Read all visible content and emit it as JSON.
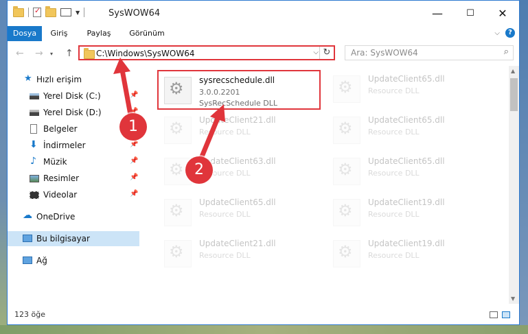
{
  "window": {
    "title": "SysWOW64",
    "buttons": {
      "minimize": "—",
      "maximize": "☐",
      "close": "✕"
    }
  },
  "ribbon": {
    "tabs": [
      "Dosya",
      "Giriş",
      "Paylaş",
      "Görünüm"
    ],
    "help": "?"
  },
  "address": {
    "path": "C:\\Windows\\SysWOW64",
    "search_placeholder": "Ara: SysWOW64"
  },
  "sidebar": {
    "items": [
      {
        "label": "Hızlı erişim",
        "icon": "star-icon",
        "pinned": false
      },
      {
        "label": "Yerel Disk (C:)",
        "icon": "drive-icon",
        "pinned": true
      },
      {
        "label": "Yerel Disk (D:)",
        "icon": "drive-icon",
        "pinned": true
      },
      {
        "label": "Belgeler",
        "icon": "documents-icon",
        "pinned": true
      },
      {
        "label": "İndirmeler",
        "icon": "download-icon",
        "pinned": true
      },
      {
        "label": "Müzik",
        "icon": "music-icon",
        "pinned": true
      },
      {
        "label": "Resimler",
        "icon": "pictures-icon",
        "pinned": true
      },
      {
        "label": "Videolar",
        "icon": "videos-icon",
        "pinned": true
      },
      {
        "label": "OneDrive",
        "icon": "cloud-icon",
        "pinned": false
      },
      {
        "label": "Bu bilgisayar",
        "icon": "computer-icon",
        "pinned": false,
        "selected": true
      },
      {
        "label": "Ağ",
        "icon": "network-icon",
        "pinned": false
      }
    ]
  },
  "files": [
    {
      "name": "sysrecschedule.dll",
      "version": "3.0.0.2201",
      "desc": "SysRecSchedule DLL",
      "highlighted": true
    },
    {
      "name": "UpdateClient65.dll",
      "version": "",
      "desc": "Resource DLL"
    },
    {
      "name": "UpdateClient21.dll",
      "version": "",
      "desc": "Resource DLL"
    },
    {
      "name": "UpdateClient65.dll",
      "version": "",
      "desc": "Resource DLL"
    },
    {
      "name": "UpdateClient63.dll",
      "version": "",
      "desc": "Resource DLL"
    },
    {
      "name": "UpdateClient65.dll",
      "version": "",
      "desc": "Resource DLL"
    },
    {
      "name": "UpdateClient65.dll",
      "version": "",
      "desc": "Resource DLL"
    },
    {
      "name": "UpdateClient19.dll",
      "version": "",
      "desc": "Resource DLL"
    },
    {
      "name": "UpdateClient21.dll",
      "version": "",
      "desc": "Resource DLL"
    },
    {
      "name": "UpdateClient19.dll",
      "version": "",
      "desc": "Resource DLL"
    }
  ],
  "status": {
    "count": "123 öğe"
  },
  "annotations": {
    "step1": "1",
    "step2": "2",
    "color": "#e0353b"
  }
}
